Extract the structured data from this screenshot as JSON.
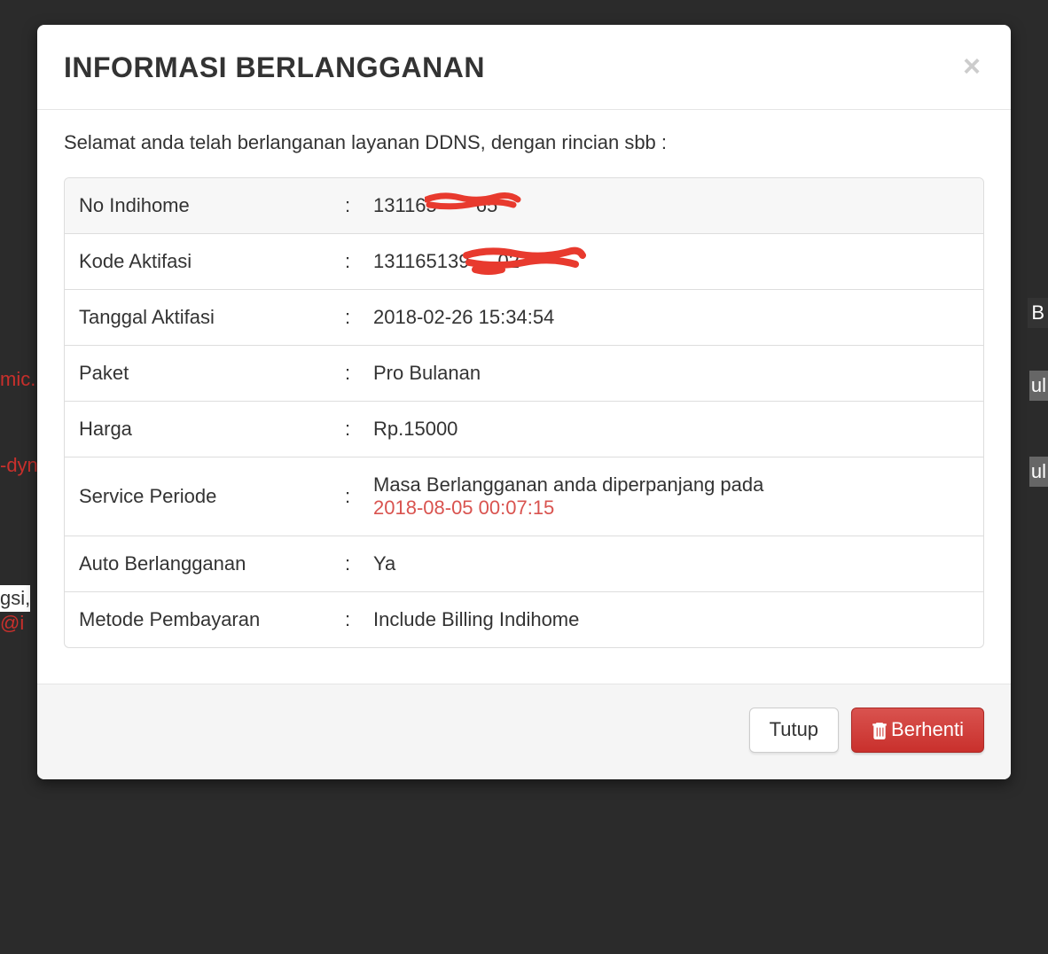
{
  "modal": {
    "title": "INFORMASI BERLANGGANAN",
    "intro": "Selamat anda telah berlanganan layanan DDNS, dengan rincian sbb :",
    "rows": [
      {
        "label": "No Indihome",
        "value_prefix": "131165",
        "value_suffix": "65"
      },
      {
        "label": "Kode Aktifasi",
        "value_prefix": "131165139",
        "value_suffix": "02"
      },
      {
        "label": "Tanggal Aktifasi",
        "value": "2018-02-26 15:34:54"
      },
      {
        "label": "Paket",
        "value": "Pro Bulanan"
      },
      {
        "label": "Harga",
        "value": "Rp.15000"
      },
      {
        "label": "Service Periode",
        "value_line1": "Masa Berlangganan anda diperpanjang pada",
        "value_line2": "2018-08-05 00:07:15"
      },
      {
        "label": "Auto Berlangganan",
        "value": "Ya"
      },
      {
        "label": "Metode Pembayaran",
        "value": "Include Billing Indihome"
      }
    ],
    "footer": {
      "close_label": "Tutup",
      "stop_label": "Berhenti"
    }
  },
  "background_fragments": {
    "f1": "mic.",
    "f2": "-dyn",
    "f3": "gsi,",
    "f4": "@i",
    "f5": "B",
    "f6": "ul",
    "f7": "ul"
  }
}
